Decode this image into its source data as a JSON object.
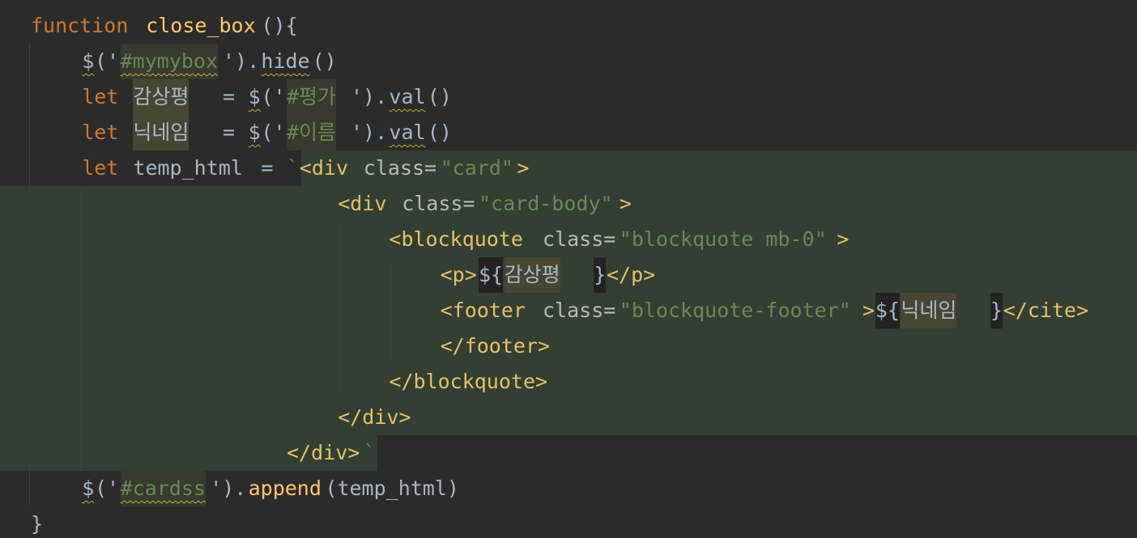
{
  "editor": {
    "lines": [
      {
        "id": "l1",
        "tokens": [
          {
            "text": "function",
            "cls": "kw",
            "col": 0
          },
          {
            "text": "close_box",
            "cls": "fn",
            "col": 9
          },
          {
            "text": "(){",
            "cls": "plain",
            "col": 18
          }
        ]
      },
      {
        "id": "l2",
        "tokens": [
          {
            "text": "$",
            "cls": "plain squig",
            "col": 4
          },
          {
            "text": "('",
            "cls": "plain",
            "col": 5
          },
          {
            "text": "#mymybox",
            "cls": "str squig hl-str",
            "col": 7
          },
          {
            "text": "').",
            "cls": "plain",
            "col": 15
          },
          {
            "text": "hide",
            "cls": "plain squig",
            "col": 18
          },
          {
            "text": "()",
            "cls": "plain",
            "col": 22
          }
        ]
      },
      {
        "id": "l3",
        "tokens": [
          {
            "text": "let",
            "cls": "kw",
            "col": 4
          },
          {
            "text": "감상평",
            "cls": "plain hl-var",
            "col": 8
          },
          {
            "text": "=",
            "cls": "plain",
            "col": 15
          },
          {
            "text": "$",
            "cls": "plain squig",
            "col": 17
          },
          {
            "text": "('",
            "cls": "plain",
            "col": 18
          },
          {
            "text": "#평가",
            "cls": "str hl-str",
            "col": 20
          },
          {
            "text": "').",
            "cls": "plain",
            "col": 25
          },
          {
            "text": "val",
            "cls": "plain squig",
            "col": 28
          },
          {
            "text": "()",
            "cls": "plain",
            "col": 31
          }
        ]
      },
      {
        "id": "l4",
        "tokens": [
          {
            "text": "let",
            "cls": "kw",
            "col": 4
          },
          {
            "text": "닉네임",
            "cls": "plain hl-var",
            "col": 8
          },
          {
            "text": "=",
            "cls": "plain",
            "col": 15
          },
          {
            "text": "$",
            "cls": "plain squig",
            "col": 17
          },
          {
            "text": "('",
            "cls": "plain",
            "col": 18
          },
          {
            "text": "#이름",
            "cls": "str hl-str",
            "col": 20
          },
          {
            "text": "').",
            "cls": "plain",
            "col": 25
          },
          {
            "text": "val",
            "cls": "plain squig",
            "col": 28
          },
          {
            "text": "()",
            "cls": "plain",
            "col": 31
          }
        ]
      },
      {
        "id": "l5",
        "tokens": [
          {
            "text": "let",
            "cls": "kw",
            "col": 4
          },
          {
            "text": "temp_html",
            "cls": "plain",
            "col": 8
          },
          {
            "text": "=",
            "cls": "plain",
            "col": 18
          },
          {
            "text": "`",
            "cls": "str",
            "col": 20
          },
          {
            "text": "<div",
            "cls": "tag",
            "col": 21
          },
          {
            "text": "class=",
            "cls": "attr",
            "col": 26
          },
          {
            "text": "\"card\"",
            "cls": "attrval",
            "col": 32
          },
          {
            "text": ">",
            "cls": "tag",
            "col": 38
          }
        ]
      },
      {
        "id": "l6",
        "tokens": [
          {
            "text": "<div",
            "cls": "tag",
            "col": 24
          },
          {
            "text": "class=",
            "cls": "attr",
            "col": 29
          },
          {
            "text": "\"card-body\"",
            "cls": "attrval",
            "col": 35
          },
          {
            "text": ">",
            "cls": "tag",
            "col": 46
          }
        ]
      },
      {
        "id": "l7",
        "tokens": [
          {
            "text": "<blockquote",
            "cls": "tag",
            "col": 28
          },
          {
            "text": "class=",
            "cls": "attr",
            "col": 40
          },
          {
            "text": "\"blockquote mb-0\"",
            "cls": "attrval",
            "col": 46
          },
          {
            "text": ">",
            "cls": "tag",
            "col": 63
          }
        ]
      },
      {
        "id": "l8",
        "tokens": [
          {
            "text": "<p>",
            "cls": "tag",
            "col": 32
          },
          {
            "text": "${",
            "cls": "plain hl-interp",
            "col": 35
          },
          {
            "text": "감상평",
            "cls": "plain hl-var",
            "col": 37
          },
          {
            "text": "}",
            "cls": "plain hl-interp",
            "col": 44
          },
          {
            "text": "</p>",
            "cls": "tag",
            "col": 45
          }
        ]
      },
      {
        "id": "l9",
        "tokens": [
          {
            "text": "<footer",
            "cls": "tag",
            "col": 32
          },
          {
            "text": "class=",
            "cls": "attr",
            "col": 40
          },
          {
            "text": "\"blockquote-footer\"",
            "cls": "attrval",
            "col": 46
          },
          {
            "text": ">",
            "cls": "tag",
            "col": 65
          },
          {
            "text": "${",
            "cls": "plain hl-interp",
            "col": 66
          },
          {
            "text": "닉네임",
            "cls": "plain hl-var",
            "col": 68
          },
          {
            "text": "}",
            "cls": "plain hl-interp",
            "col": 75
          },
          {
            "text": "</cite>",
            "cls": "tag",
            "col": 76
          }
        ]
      },
      {
        "id": "l10",
        "tokens": [
          {
            "text": "</footer>",
            "cls": "tag",
            "col": 32
          }
        ]
      },
      {
        "id": "l11",
        "tokens": [
          {
            "text": "</blockquote>",
            "cls": "tag",
            "col": 28
          }
        ]
      },
      {
        "id": "l12",
        "tokens": [
          {
            "text": "</div>",
            "cls": "tag",
            "col": 24
          }
        ]
      },
      {
        "id": "l13",
        "tokens": [
          {
            "text": "</div>",
            "cls": "tag",
            "col": 20
          },
          {
            "text": "`",
            "cls": "str",
            "col": 26
          }
        ]
      },
      {
        "id": "l14",
        "tokens": [
          {
            "text": "$",
            "cls": "plain squig",
            "col": 4
          },
          {
            "text": "('",
            "cls": "plain",
            "col": 5
          },
          {
            "text": "#cardss",
            "cls": "str squig hl-str",
            "col": 7
          },
          {
            "text": "').",
            "cls": "plain",
            "col": 14
          },
          {
            "text": "append",
            "cls": "fn",
            "col": 17
          },
          {
            "text": "(temp_html)",
            "cls": "plain",
            "col": 23
          }
        ]
      },
      {
        "id": "l15",
        "tokens": [
          {
            "text": "}",
            "cls": "plain",
            "col": 0
          }
        ]
      }
    ]
  }
}
